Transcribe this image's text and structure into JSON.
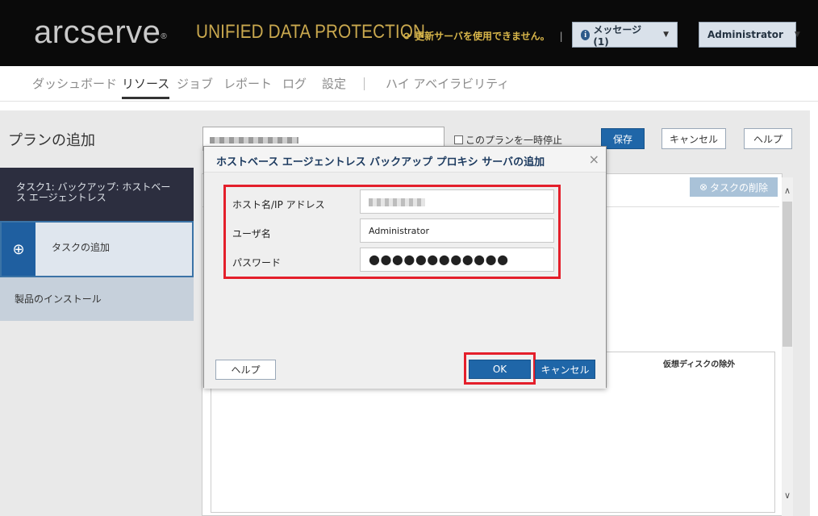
{
  "header": {
    "logo": "arcserve",
    "logo_mark": "®",
    "product": "UNIFIED DATA PROTECTION",
    "update_notice": "更新サーバを使用できません。",
    "messages_label": "メッセージ (1)",
    "user_label": "Administrator"
  },
  "nav": {
    "items": [
      "ダッシュボード",
      "リソース",
      "ジョブ",
      "レポート",
      "ログ",
      "設定",
      "ハイ アベイラビリティ"
    ],
    "active": "リソース"
  },
  "plan": {
    "title": "プランの追加",
    "pause_label": "このプランを一時停止",
    "save_label": "保存",
    "cancel_label": "キャンセル",
    "help_label": "ヘルプ"
  },
  "sidebar": {
    "task1": "タスク1: バックアップ: ホストベース エージェントレス",
    "add_task": "タスクの追加",
    "install": "製品のインストール"
  },
  "content": {
    "delete_task": "タスクの削除",
    "virtual_disk_exclusion": "仮想ディスクの除外"
  },
  "dialog": {
    "title": "ホストベース エージェントレス バックアップ プロキシ サーバの追加",
    "hostname_label": "ホスト名/IP アドレス",
    "username_label": "ユーザ名",
    "username_value": "Administrator",
    "password_label": "パスワード",
    "password_value": "●●●●●●●●●●●●",
    "help_label": "ヘルプ",
    "ok_label": "OK",
    "cancel_label": "キャンセル"
  },
  "colors": {
    "header_bg": "#0a0a0a",
    "product_gold": "#c9a84e",
    "primary_blue": "#1f66a8",
    "highlight_red": "#e41f2b"
  }
}
